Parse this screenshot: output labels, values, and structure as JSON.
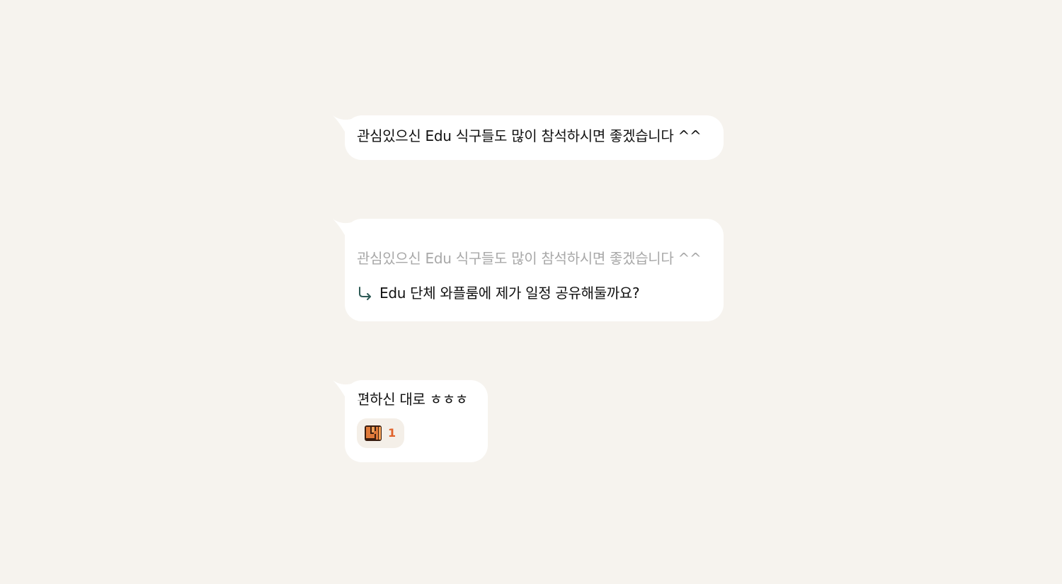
{
  "messages": [
    {
      "text": "관심있으신 Edu 식구들도 많이 참석하시면 좋겠습니다 ^^"
    },
    {
      "quoted_text": "관심있으신 Edu 식구들도 많이 참석하시면 좋겠습니다 ^^",
      "reply_icon": "reply-arrow-icon",
      "text": "Edu 단체 와플룸에 제가 일정 공유해둘까요?"
    },
    {
      "text": "편하신 대로 ㅎㅎㅎ",
      "reaction": {
        "emoji_icon": "ne-sticker-icon",
        "count": "1"
      }
    }
  ],
  "colors": {
    "background": "#f6f3ee",
    "bubble": "#ffffff",
    "quoted_text": "#a8a8a8",
    "reply_icon": "#2f5b57",
    "reaction_bg": "#f4efe8",
    "reaction_count": "#e0622a"
  }
}
